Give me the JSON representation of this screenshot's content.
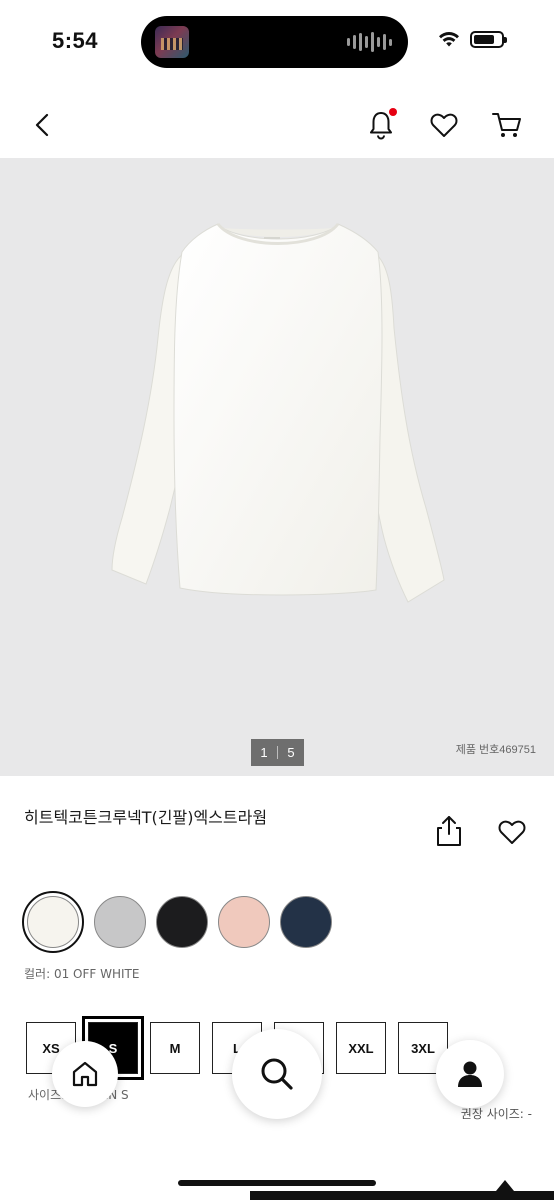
{
  "status_bar": {
    "time": "5:54",
    "battery_level": 0.75
  },
  "header": {
    "back_icon": "chevron-left-icon",
    "notification_icon": "bell-icon",
    "wishlist_icon": "heart-icon",
    "cart_icon": "cart-icon",
    "notification_dot_color": "#e60012"
  },
  "gallery": {
    "current_page": "1",
    "total_pages": "5",
    "product_number": "제품 번호469751"
  },
  "product": {
    "name": "히트텍코튼크루넥T(긴팔)엑스트라웜"
  },
  "colors": {
    "swatches": [
      {
        "name": "off-white",
        "hex": "#f6f4ee",
        "selected": true
      },
      {
        "name": "gray",
        "hex": "#c7c7c8",
        "selected": false
      },
      {
        "name": "black",
        "hex": "#1c1c1e",
        "selected": false
      },
      {
        "name": "pink",
        "hex": "#f0c9bd",
        "selected": false
      },
      {
        "name": "navy",
        "hex": "#233247",
        "selected": false
      }
    ],
    "label": "컬러: 01 OFF WHITE"
  },
  "sizes": {
    "options": [
      "XS",
      "S",
      "M",
      "L",
      "XL",
      "XXL",
      "3XL"
    ],
    "selected": "S",
    "label": "사이즈: WOMEN S",
    "recommended": "권장 사이즈: -"
  },
  "nav": {
    "home_icon": "home-icon",
    "search_icon": "search-icon",
    "account_icon": "user-icon"
  }
}
